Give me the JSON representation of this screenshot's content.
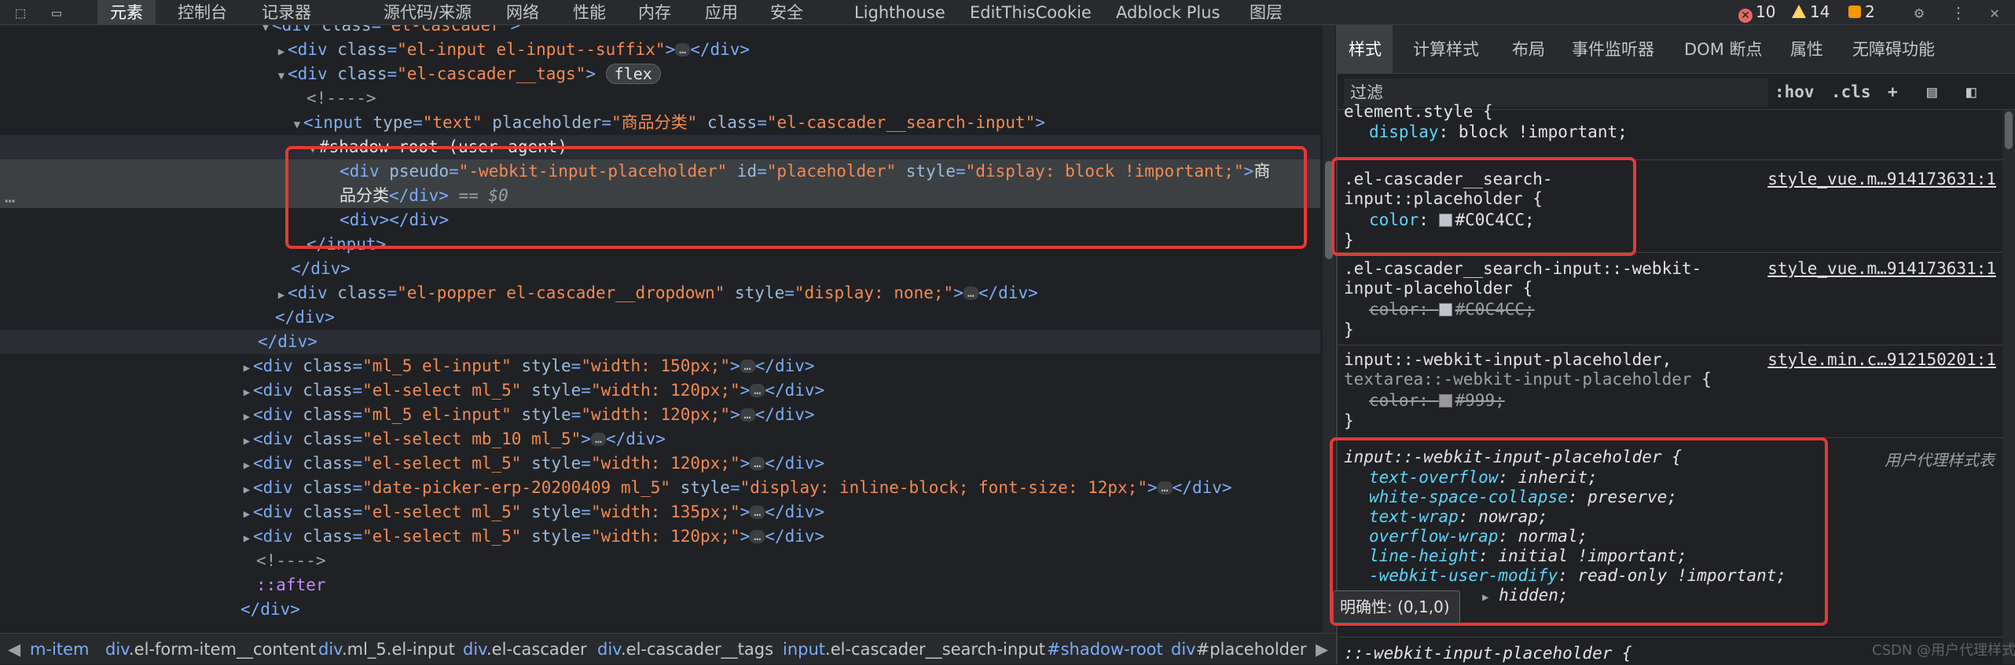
{
  "toolbar": {
    "tabs": [
      "元素",
      "控制台",
      "记录器",
      "源代码/来源",
      "网络",
      "性能",
      "内存",
      "应用",
      "安全",
      "Lighthouse",
      "EditThisCookie",
      "Adblock Plus",
      "图层"
    ],
    "errors": "10",
    "warnings": "14",
    "info": "2"
  },
  "elements": {
    "l0_tag": "div",
    "l0_attr": "class",
    "l0_val": "\"el-cascader\"",
    "l1_tag": "div",
    "l1_attr": "class",
    "l1_val": "\"el-input el-input--suffix\"",
    "l1_close": "div",
    "l2_tag": "div",
    "l2_attr": "class",
    "l2_val": "\"el-cascader__tags\"",
    "l2_badge": "flex",
    "l3_comment": "<!---->",
    "l4_tag": "input",
    "l4_a1": "type",
    "l4_v1": "\"text\"",
    "l4_a2": "placeholder",
    "l4_v2": "\"商品分类\"",
    "l4_a3": "class",
    "l4_v3": "\"el-cascader__search-input\"",
    "l5_text": "#shadow-root (user-agent)",
    "l6_tag": "div",
    "l6_a1": "pseudo",
    "l6_v1": "\"-webkit-input-placeholder\"",
    "l6_a2": "id",
    "l6_v2": "\"placeholder\"",
    "l6_a3": "style",
    "l6_v3": "\"display: block !important;\"",
    "l6_text": "商",
    "l7_text": "品分类",
    "l7_close": "div",
    "l7_marker": "== $0",
    "l8_tag": "div",
    "l9_close": "input",
    "l10_close": "div",
    "l11_tag": "div",
    "l11_a1": "class",
    "l11_v1": "\"el-popper el-cascader__dropdown\"",
    "l11_a2": "style",
    "l11_v2": "\"display: none;\"",
    "l11_close": "div",
    "l12_close": "div",
    "l13_close": "div",
    "l14_tag": "div",
    "l14_a1": "class",
    "l14_v1": "\"ml_5 el-input\"",
    "l14_a2": "style",
    "l14_v2": "\"width: 150px;\"",
    "l15_tag": "div",
    "l15_a1": "class",
    "l15_v1": "\"el-select ml_5\"",
    "l15_a2": "style",
    "l15_v2": "\"width: 120px;\"",
    "l16_tag": "div",
    "l16_a1": "class",
    "l16_v1": "\"ml_5 el-input\"",
    "l16_a2": "style",
    "l16_v2": "\"width: 120px;\"",
    "l17_tag": "div",
    "l17_a1": "class",
    "l17_v1": "\"el-select mb_10 ml_5\"",
    "l18_tag": "div",
    "l18_a1": "class",
    "l18_v1": "\"el-select ml_5\"",
    "l18_a2": "style",
    "l18_v2": "\"width: 120px;\"",
    "l19_tag": "div",
    "l19_a1": "class",
    "l19_v1": "\"date-picker-erp-20200409 ml_5\"",
    "l19_a2": "style",
    "l19_v2": "\"display: inline-block; font-size: 12px;\"",
    "l20_tag": "div",
    "l20_a1": "class",
    "l20_v1": "\"el-select ml_5\"",
    "l20_a2": "style",
    "l20_v2": "\"width: 135px;\"",
    "l21_tag": "div",
    "l21_a1": "class",
    "l21_v1": "\"el-select ml_5\"",
    "l21_a2": "style",
    "l21_v2": "\"width: 120px;\"",
    "l22_comment": "<!---->",
    "l23_pseudo": "::after",
    "l24_close": "div",
    "ellipsis": "…"
  },
  "breadcrumb": {
    "b1": "m-item",
    "b2_tag": "div",
    "b2_cls": ".el-form-item__content",
    "b3_tag": "div",
    "b3_cls": ".ml_5.el-input",
    "b4_tag": "div",
    "b4_cls": ".el-cascader",
    "b5_tag": "div",
    "b5_cls": ".el-cascader__tags",
    "b6_tag": "input",
    "b6_cls": ".el-cascader__search-input",
    "b7": "#shadow-root",
    "b8_tag": "div",
    "b8_id": "#placeholder"
  },
  "styles": {
    "tabs": [
      "样式",
      "计算样式",
      "布局",
      "事件监听器",
      "DOM 断点",
      "属性",
      "无障碍功能"
    ],
    "filter_placeholder": "过滤",
    "hov": ":hov",
    "cls": ".cls",
    "r0_sel": "element.style {",
    "r0_p": "display",
    "r0_v": "block !important;",
    "r1_sel1": ".el-cascader__search-",
    "r1_sel2": "input::placeholder {",
    "r1_src": "style_vue.m…914173631:1",
    "r1_p": "color",
    "r1_v": "#C0C4CC;",
    "r2_sel1": ".el-cascader__search-input::-webkit-",
    "r2_sel2": "input-placeholder {",
    "r2_src": "style_vue.m…914173631:1",
    "r2_p": "color",
    "r2_v": "#C0C4CC;",
    "r3_sel1": "input::-webkit-input-placeholder,",
    "r3_sel2": "textarea::-webkit-input-placeholder",
    "r3_brace": "{",
    "r3_src": "style.min.c…912150201:1",
    "r3_p": "color",
    "r3_v": "#999;",
    "r4_sel": "input::-webkit-input-placeholder {",
    "r4_src": "用户代理样式表",
    "r4_p1": "text-overflow",
    "r4_v1": "inherit;",
    "r4_p2": "white-space-collapse",
    "r4_v2": "preserve;",
    "r4_p3": "text-wrap",
    "r4_v3": "nowrap;",
    "r4_p4": "overflow-wrap",
    "r4_v4": "normal;",
    "r4_p5": "line-height",
    "r4_v5": "initial !important;",
    "r4_p6": "-webkit-user-modify",
    "r4_v6": "read-only !important;",
    "r4_v7": "hidden;",
    "r5_sel": "::-webkit-input-placeholder {",
    "close_brace": "}",
    "tooltip_label": "明确性:",
    "tooltip_value": "(0,1,0)",
    "watermark": "CSDN @用户代理样式表",
    "colors": {
      "placeholder": "#C0C4CC",
      "legacy": "#999"
    }
  },
  "colors": {
    "highlight": "#e53935",
    "tag": "#7cacf8",
    "attr_value": "#f28b54",
    "prop": "#5cd5fb"
  }
}
